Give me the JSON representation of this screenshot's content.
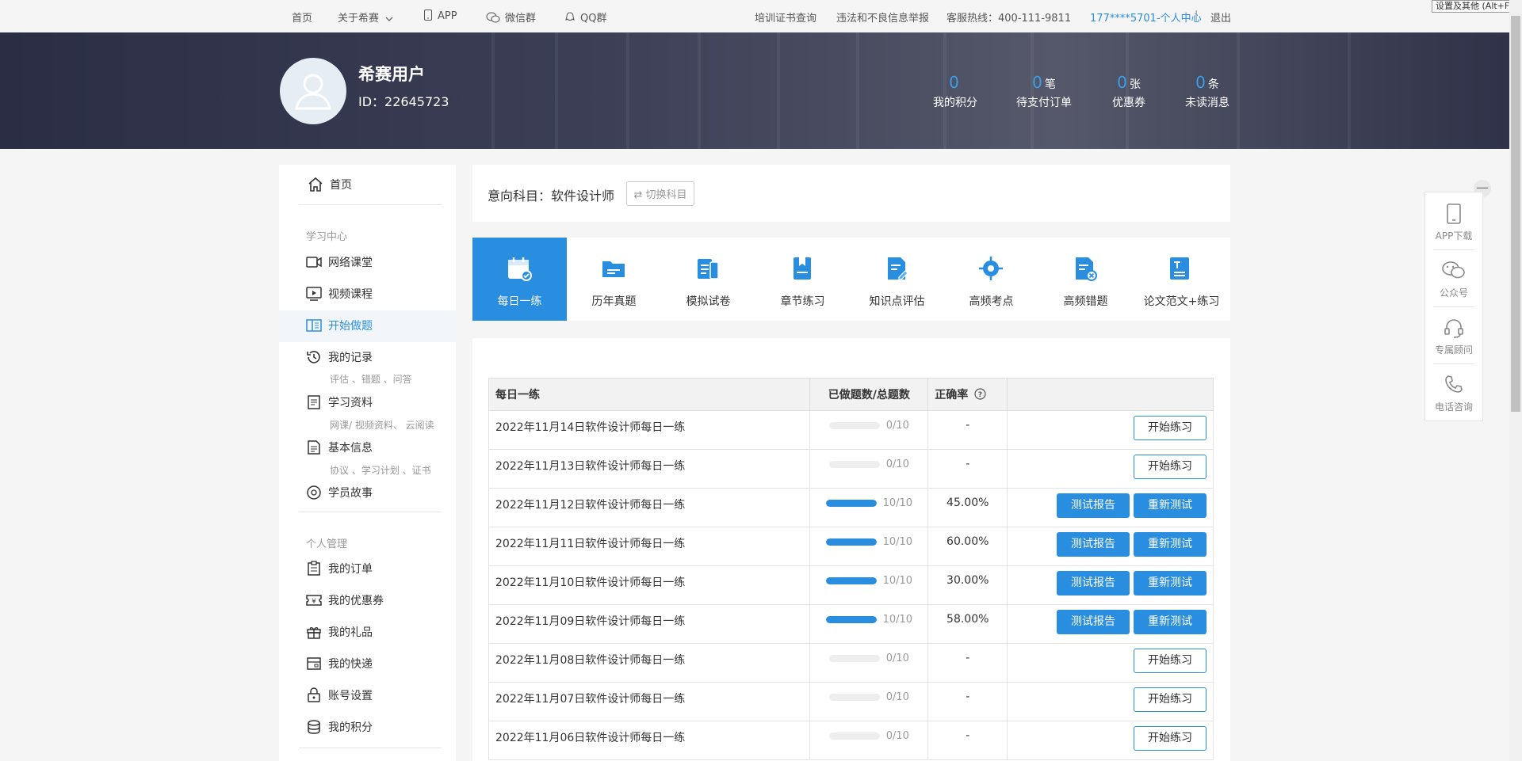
{
  "topbar": {
    "home": "首页",
    "about": "关于希赛",
    "app": "APP",
    "wechat": "微信群",
    "qq": "QQ群",
    "cert": "培训证书查询",
    "report": "违法和不良信息举报",
    "hotline": "客服热线：400-111-9811",
    "user_center": "177****5701-个人中心",
    "separator": "|",
    "logout": "退出"
  },
  "profile": {
    "name": "希赛用户",
    "id": "ID：22645723",
    "stats": [
      {
        "num": "0",
        "unit": "",
        "label": "我的积分"
      },
      {
        "num": "0",
        "unit": "笔",
        "label": "待支付订单"
      },
      {
        "num": "0",
        "unit": "张",
        "label": "优惠券"
      },
      {
        "num": "0",
        "unit": "条",
        "label": "未读消息"
      }
    ]
  },
  "sidebar": {
    "home": "首页",
    "study_title": "学习中心",
    "online_class": "网络课堂",
    "video_course": "视频课程",
    "start_practice": "开始做题",
    "my_records": "我的记录",
    "my_records_sub": "评估 、错题 、问答",
    "study_material": "学习资料",
    "study_material_sub": "网课/ 视频资料、 云阅读",
    "basic_info": "基本信息",
    "basic_info_sub": "协议 、学习计划 、证书",
    "stories": "学员故事",
    "personal_title": "个人管理",
    "orders": "我的订单",
    "coupons": "我的优惠券",
    "gifts": "我的礼品",
    "express": "我的快递",
    "account": "账号设置",
    "points": "我的积分"
  },
  "subject": {
    "label": "意向科目：软件设计师",
    "switch": "⇄ 切换科目"
  },
  "tabs": [
    {
      "label": "每日一练"
    },
    {
      "label": "历年真题"
    },
    {
      "label": "模拟试卷"
    },
    {
      "label": "章节练习"
    },
    {
      "label": "知识点评估"
    },
    {
      "label": "高频考点"
    },
    {
      "label": "高频错题"
    },
    {
      "label": "论文范文+练习"
    }
  ],
  "table": {
    "headers": [
      "每日一练",
      "已做题数/总题数",
      "正确率"
    ],
    "rows": [
      {
        "title": "2022年11月14日软件设计师每日一练",
        "progress": "0/10",
        "done": 0,
        "rate": "-",
        "actions": [
          "开始练习"
        ]
      },
      {
        "title": "2022年11月13日软件设计师每日一练",
        "progress": "0/10",
        "done": 0,
        "rate": "-",
        "actions": [
          "开始练习"
        ]
      },
      {
        "title": "2022年11月12日软件设计师每日一练",
        "progress": "10/10",
        "done": 1,
        "rate": "45.00%",
        "actions": [
          "测试报告",
          "重新测试"
        ]
      },
      {
        "title": "2022年11月11日软件设计师每日一练",
        "progress": "10/10",
        "done": 1,
        "rate": "60.00%",
        "actions": [
          "测试报告",
          "重新测试"
        ]
      },
      {
        "title": "2022年11月10日软件设计师每日一练",
        "progress": "10/10",
        "done": 1,
        "rate": "30.00%",
        "actions": [
          "测试报告",
          "重新测试"
        ]
      },
      {
        "title": "2022年11月09日软件设计师每日一练",
        "progress": "10/10",
        "done": 1,
        "rate": "58.00%",
        "actions": [
          "测试报告",
          "重新测试"
        ]
      },
      {
        "title": "2022年11月08日软件设计师每日一练",
        "progress": "0/10",
        "done": 0,
        "rate": "-",
        "actions": [
          "开始练习"
        ]
      },
      {
        "title": "2022年11月07日软件设计师每日一练",
        "progress": "0/10",
        "done": 0,
        "rate": "-",
        "actions": [
          "开始练习"
        ]
      },
      {
        "title": "2022年11月06日软件设计师每日一练",
        "progress": "0/10",
        "done": 0,
        "rate": "-",
        "actions": [
          "开始练习"
        ]
      }
    ]
  },
  "floating": {
    "app": "APP下载",
    "wechat": "公众号",
    "advisor": "专属顾问",
    "phone": "电话咨询",
    "close": "—"
  },
  "tooltip": "设置及其他 (Alt+F)",
  "colors": {
    "accent": "#2a8ee0",
    "stat_num": "#3a9ee8",
    "banner": "#2a2d44"
  }
}
